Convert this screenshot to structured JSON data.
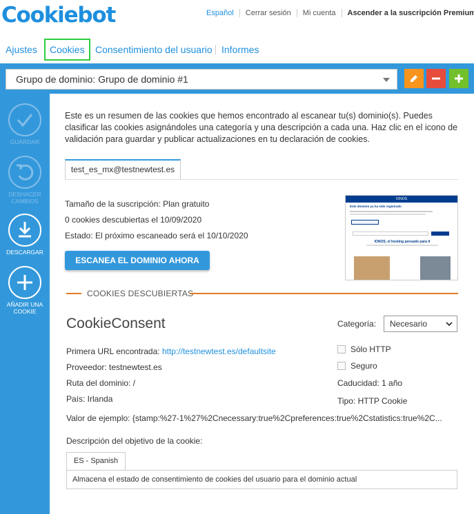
{
  "brand": {
    "logo": "Cookiebot",
    "color": "#1e8fde"
  },
  "toplinks": {
    "language": "Español",
    "logout": "Cerrar sesión",
    "account": "Mi cuenta",
    "upgrade": "Ascender a la suscripción Premium"
  },
  "nav": {
    "items": [
      "Ajustes",
      "Cookies",
      "Consentimiento del usuario",
      "Informes"
    ],
    "active": "Cookies"
  },
  "domain_group": {
    "selected": "Grupo de dominio: Grupo de dominio #1"
  },
  "sidebar": {
    "save": "GUARDAR",
    "undo": "DESHACER CAMBIOS",
    "download": "DESCARGAR",
    "add_cookie": "AÑADIR UNA COOKIE"
  },
  "intro": "Este es un resumen de las cookies que hemos encontrado al escanear tu(s) dominio(s). Puedes clasificar las cookies asignándoles una categoría y una descripción a cada una. Haz clic en el icono de validación para guardar y publicar actualizaciones en tu declaración de cookies.",
  "domain_tab": "test_es_mx@testnewtest.es",
  "subscription": "Tamaño de la suscripción: Plan gratuito",
  "discovered": "0 cookies descubiertas el 10/09/2020",
  "status": "Estado: El próximo escaneado será el 10/10/2020",
  "scan_button": "ESCANEA EL DOMINIO AHORA",
  "thumbnail": {
    "brand": "IONOS",
    "heading": "Este dominio ya ha sido registrado",
    "headline": "IONOS, el hosting pensado para ti"
  },
  "section_title": "COOKIES DESCUBIERTAS",
  "cookie": {
    "name": "CookieConsent",
    "first_url_label": "Primera URL encontrada: ",
    "first_url": "http://testnewtest.es/defaultsite",
    "provider": "Proveedor: testnewtest.es",
    "path": "Ruta del dominio: /",
    "country": "País: Irlanda",
    "sample": "Valor de ejemplo: {stamp:%27-1%27%2Cnecessary:true%2Cpreferences:true%2Cstatistics:true%2C...",
    "category_label": "Categoría:",
    "category": "Necesario",
    "http_only": "Sólo HTTP",
    "secure": "Seguro",
    "expiry": "Caducidad: 1 año",
    "type": "Tipo: HTTP Cookie",
    "description_label": "Descripción del objetivo de la cookie:",
    "language_tab": "ES - Spanish",
    "description": "Almacena el estado de consentimiento de cookies del usuario para el dominio actual"
  }
}
